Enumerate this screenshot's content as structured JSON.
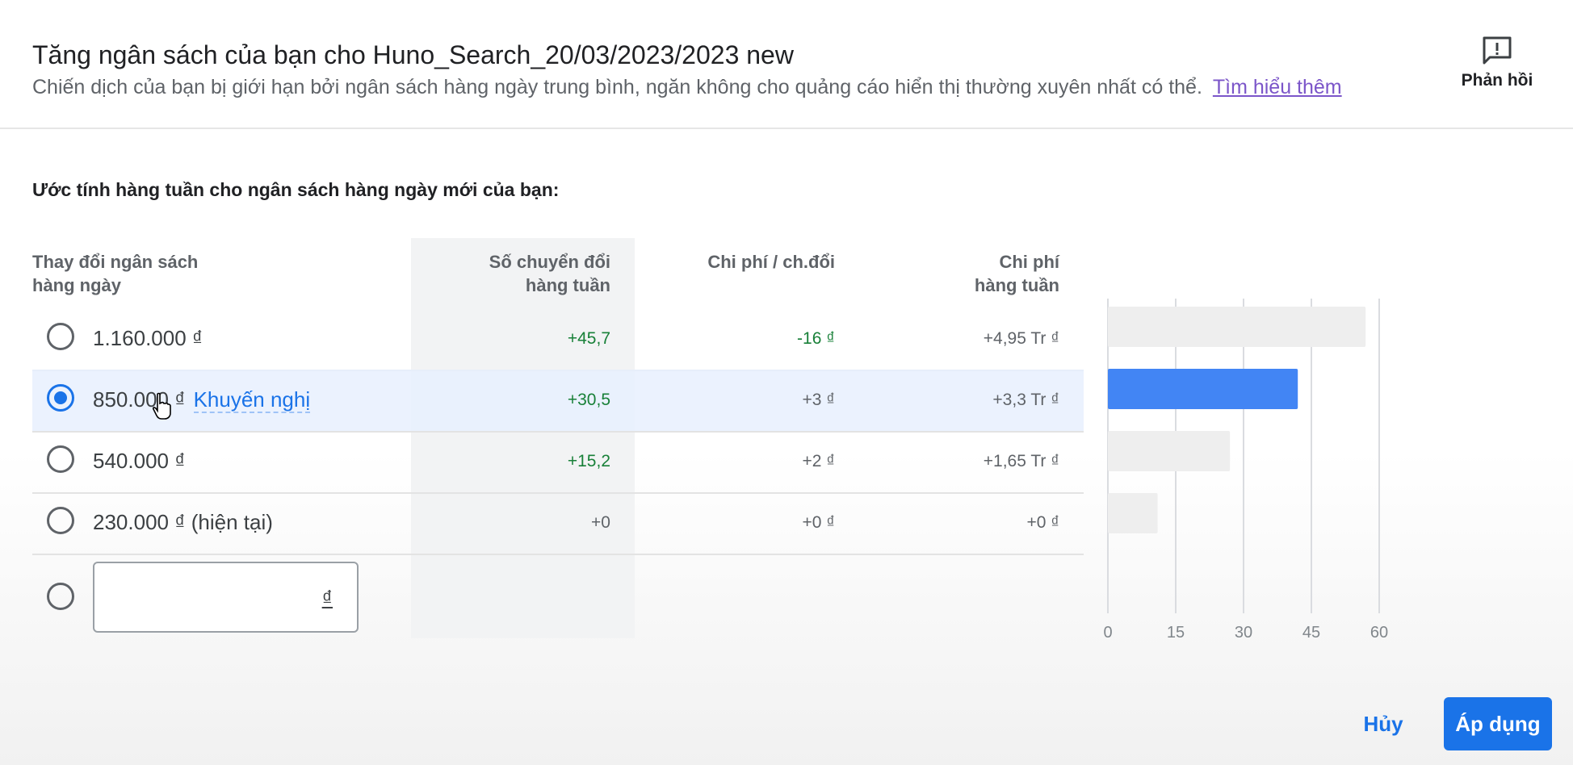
{
  "header": {
    "title": "Tăng ngân sách của bạn cho Huno_Search_20/03/2023/2023 new",
    "subtitle": "Chiến dịch của bạn bị giới hạn bởi ngân sách hàng ngày trung bình, ngăn không cho quảng cáo hiển thị thường xuyên nhất có thể.",
    "learn_more": "Tìm hiểu thêm",
    "feedback_label": "Phản hồi",
    "feedback_icon": "feedback-icon"
  },
  "section_heading": "Ước tính hàng tuần cho ngân sách hàng ngày mới của bạn:",
  "columns": {
    "budget_line1": "Thay đổi ngân sách",
    "budget_line2": "hàng ngày",
    "conv_line1": "Số chuyển đổi",
    "conv_line2": "hàng tuần",
    "cpa": "Chi phí / ch.đổi",
    "cost_line1": "Chi phí",
    "cost_line2": "hàng tuần"
  },
  "rows": [
    {
      "budget": "1.160.000 ₫",
      "badge": "",
      "conversions": "+45,7",
      "cpa": "-16 ₫",
      "cost": "+4,95 Tr ₫",
      "selected": false
    },
    {
      "budget": "850.000 ₫",
      "badge": "Khuyến nghị",
      "conversions": "+30,5",
      "cpa": "+3 ₫",
      "cost": "+3,3 Tr ₫",
      "selected": true
    },
    {
      "budget": "540.000 ₫",
      "badge": "",
      "conversions": "+15,2",
      "cpa": "+2 ₫",
      "cost": "+1,65 Tr ₫",
      "selected": false
    },
    {
      "budget": "230.000 ₫ (hiện tại)",
      "badge": "",
      "conversions": "+0",
      "cpa": "+0 ₫",
      "cost": "+0 ₫",
      "selected": false
    }
  ],
  "custom_input": {
    "value": "",
    "suffix": "₫"
  },
  "chart_data": {
    "type": "bar",
    "orientation": "horizontal",
    "categories": [
      "1.160.000 ₫",
      "850.000 ₫",
      "540.000 ₫",
      "230.000 ₫ (hiện tại)"
    ],
    "values": [
      57,
      42,
      27,
      11
    ],
    "highlight_index": 1,
    "xlim": [
      0,
      60
    ],
    "xticks": [
      "0",
      "15",
      "30",
      "45",
      "60"
    ],
    "grid": true,
    "colors": {
      "highlight": "#4285f4",
      "default": "#eeeeee"
    }
  },
  "footer": {
    "cancel": "Hủy",
    "apply": "Áp dụng"
  },
  "colors": {
    "accent": "#1a73e8",
    "positive": "#188038"
  }
}
